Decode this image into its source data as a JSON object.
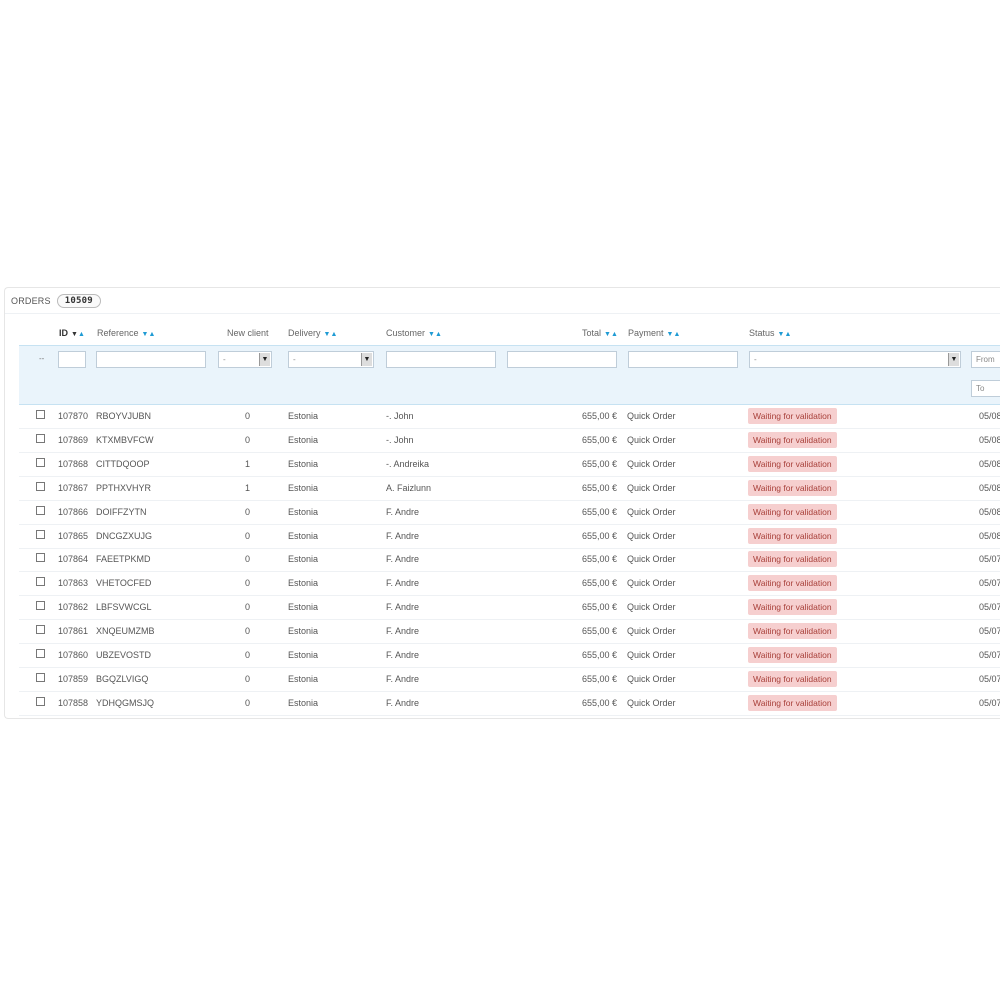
{
  "panel": {
    "title": "ORDERS",
    "count": "10509"
  },
  "columns": {
    "id": "ID",
    "reference": "Reference",
    "new_client": "New client",
    "delivery": "Delivery",
    "customer": "Customer",
    "total": "Total",
    "payment": "Payment",
    "status": "Status"
  },
  "filters": {
    "reset": "--",
    "new_client_value": "-",
    "delivery_value": "-",
    "status_value": "-",
    "date_from": "From",
    "date_to": "To"
  },
  "rows": [
    {
      "id": "107870",
      "reference": "RBOYVJUBN",
      "new_client": "0",
      "delivery": "Estonia",
      "customer": "-. John",
      "total": "655,00 €",
      "payment": "Quick Order",
      "status": "Waiting for validation",
      "date": "05/08"
    },
    {
      "id": "107869",
      "reference": "KTXMBVFCW",
      "new_client": "0",
      "delivery": "Estonia",
      "customer": "-. John",
      "total": "655,00 €",
      "payment": "Quick Order",
      "status": "Waiting for validation",
      "date": "05/08"
    },
    {
      "id": "107868",
      "reference": "CITTDQOOP",
      "new_client": "1",
      "delivery": "Estonia",
      "customer": "-. Andreika",
      "total": "655,00 €",
      "payment": "Quick Order",
      "status": "Waiting for validation",
      "date": "05/08"
    },
    {
      "id": "107867",
      "reference": "PPTHXVHYR",
      "new_client": "1",
      "delivery": "Estonia",
      "customer": "A. Faizlunn",
      "total": "655,00 €",
      "payment": "Quick Order",
      "status": "Waiting for validation",
      "date": "05/08"
    },
    {
      "id": "107866",
      "reference": "DOIFFZYTN",
      "new_client": "0",
      "delivery": "Estonia",
      "customer": "F. Andre",
      "total": "655,00 €",
      "payment": "Quick Order",
      "status": "Waiting for validation",
      "date": "05/08"
    },
    {
      "id": "107865",
      "reference": "DNCGZXUJG",
      "new_client": "0",
      "delivery": "Estonia",
      "customer": "F. Andre",
      "total": "655,00 €",
      "payment": "Quick Order",
      "status": "Waiting for validation",
      "date": "05/08"
    },
    {
      "id": "107864",
      "reference": "FAEETPKMD",
      "new_client": "0",
      "delivery": "Estonia",
      "customer": "F. Andre",
      "total": "655,00 €",
      "payment": "Quick Order",
      "status": "Waiting for validation",
      "date": "05/07"
    },
    {
      "id": "107863",
      "reference": "VHETOCFED",
      "new_client": "0",
      "delivery": "Estonia",
      "customer": "F. Andre",
      "total": "655,00 €",
      "payment": "Quick Order",
      "status": "Waiting for validation",
      "date": "05/07"
    },
    {
      "id": "107862",
      "reference": "LBFSVWCGL",
      "new_client": "0",
      "delivery": "Estonia",
      "customer": "F. Andre",
      "total": "655,00 €",
      "payment": "Quick Order",
      "status": "Waiting for validation",
      "date": "05/07"
    },
    {
      "id": "107861",
      "reference": "XNQEUMZMB",
      "new_client": "0",
      "delivery": "Estonia",
      "customer": "F. Andre",
      "total": "655,00 €",
      "payment": "Quick Order",
      "status": "Waiting for validation",
      "date": "05/07"
    },
    {
      "id": "107860",
      "reference": "UBZEVOSTD",
      "new_client": "0",
      "delivery": "Estonia",
      "customer": "F. Andre",
      "total": "655,00 €",
      "payment": "Quick Order",
      "status": "Waiting for validation",
      "date": "05/07"
    },
    {
      "id": "107859",
      "reference": "BGQZLVIGQ",
      "new_client": "0",
      "delivery": "Estonia",
      "customer": "F. Andre",
      "total": "655,00 €",
      "payment": "Quick Order",
      "status": "Waiting for validation",
      "date": "05/07"
    },
    {
      "id": "107858",
      "reference": "YDHQGMSJQ",
      "new_client": "0",
      "delivery": "Estonia",
      "customer": "F. Andre",
      "total": "655,00 €",
      "payment": "Quick Order",
      "status": "Waiting for validation",
      "date": "05/07"
    }
  ],
  "colors": {
    "accent": "#1f9bd4",
    "status_bg": "#f6cfcf",
    "status_text": "#a8403a",
    "filter_bg": "#eaf4fb"
  }
}
